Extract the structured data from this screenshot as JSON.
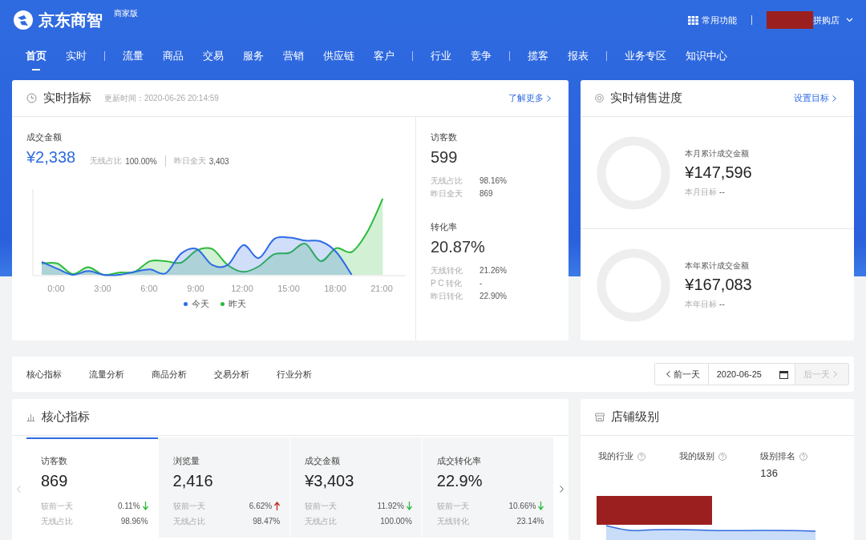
{
  "header": {
    "logo": "京东商智",
    "edition": "商家版",
    "quick_menu": "常用功能",
    "store": "拼购店"
  },
  "nav": [
    [
      {
        "label": "首页",
        "selected": true
      },
      {
        "label": "实时",
        "selected": false
      }
    ],
    [
      {
        "label": "流量",
        "selected": false
      },
      {
        "label": "商品",
        "selected": false
      },
      {
        "label": "交易",
        "selected": false
      },
      {
        "label": "服务",
        "selected": false
      },
      {
        "label": "营销",
        "selected": false
      },
      {
        "label": "供应链",
        "selected": false
      },
      {
        "label": "客户",
        "selected": false
      }
    ],
    [
      {
        "label": "行业",
        "selected": false
      },
      {
        "label": "竞争",
        "selected": false
      }
    ],
    [
      {
        "label": "揽客",
        "selected": false
      },
      {
        "label": "报表",
        "selected": false
      }
    ],
    [
      {
        "label": "业务专区",
        "selected": false
      },
      {
        "label": "知识中心",
        "selected": false
      }
    ]
  ],
  "realtime": {
    "title": "实时指标",
    "update_time": "更新时间：2020-06-26 20:14:59",
    "more": "了解更多",
    "amount": {
      "label": "成交金额",
      "value": "¥2,338",
      "stats": [
        {
          "label": "无线占比",
          "value": "100.00%"
        },
        {
          "label": "昨日全天",
          "value": "3,403"
        }
      ]
    },
    "x_labels": [
      "0:00",
      "3:00",
      "6:00",
      "9:00",
      "12:00",
      "15:00",
      "18:00",
      "21:00"
    ],
    "legend": [
      {
        "label": "今天",
        "color": "#2e6be6"
      },
      {
        "label": "昨天",
        "color": "#2dbb3c"
      }
    ],
    "side": [
      {
        "label": "访客数",
        "value": "599",
        "stats": [
          {
            "label": "无线占比",
            "value": "98.16%"
          },
          {
            "label": "昨日全天",
            "value": "869"
          }
        ]
      },
      {
        "label": "转化率",
        "value": "20.87%",
        "stats": [
          {
            "label": "无线转化",
            "value": "21.26%"
          },
          {
            "label": "P C 转化",
            "value": "-"
          },
          {
            "label": "昨日转化",
            "value": "22.90%"
          }
        ]
      }
    ]
  },
  "sales_progress": {
    "title": "实时销售进度",
    "action": "设置目标",
    "items": [
      {
        "label": "本月累计成交金额",
        "value": "¥147,596",
        "target_label": "本月目标",
        "target": "--"
      },
      {
        "label": "本年累计成交金额",
        "value": "¥167,083",
        "target_label": "本年目标",
        "target": "--"
      }
    ]
  },
  "analysis_tabs": [
    "核心指标",
    "流量分析",
    "商品分析",
    "交易分析",
    "行业分析"
  ],
  "date_nav": {
    "prev": "前一天",
    "date": "2020-06-25",
    "next": "后一天",
    "next_disabled": true
  },
  "core": {
    "title": "核心指标",
    "metrics": [
      {
        "label": "访客数",
        "value": "869",
        "selected": true,
        "compare_label": "较前一天",
        "compare": "0.11%",
        "rising": false,
        "sub_label": "无线占比",
        "sub": "98.96%"
      },
      {
        "label": "浏览量",
        "value": "2,416",
        "selected": false,
        "compare_label": "较前一天",
        "compare": "6.62%",
        "rising": true,
        "sub_label": "无线占比",
        "sub": "98.47%"
      },
      {
        "label": "成交金额",
        "value": "¥3,403",
        "selected": false,
        "compare_label": "较前一天",
        "compare": "11.92%",
        "rising": false,
        "sub_label": "无线占比",
        "sub": "100.00%"
      },
      {
        "label": "成交转化率",
        "value": "22.9%",
        "selected": false,
        "compare_label": "较前一天",
        "compare": "10.66%",
        "rising": false,
        "sub_label": "无线转化",
        "sub": "23.14%"
      }
    ]
  },
  "store_level": {
    "title": "店铺级别",
    "columns": [
      {
        "label": "我的行业"
      },
      {
        "label": "我的级别"
      },
      {
        "label": "级别排名",
        "value": "136"
      }
    ]
  }
}
